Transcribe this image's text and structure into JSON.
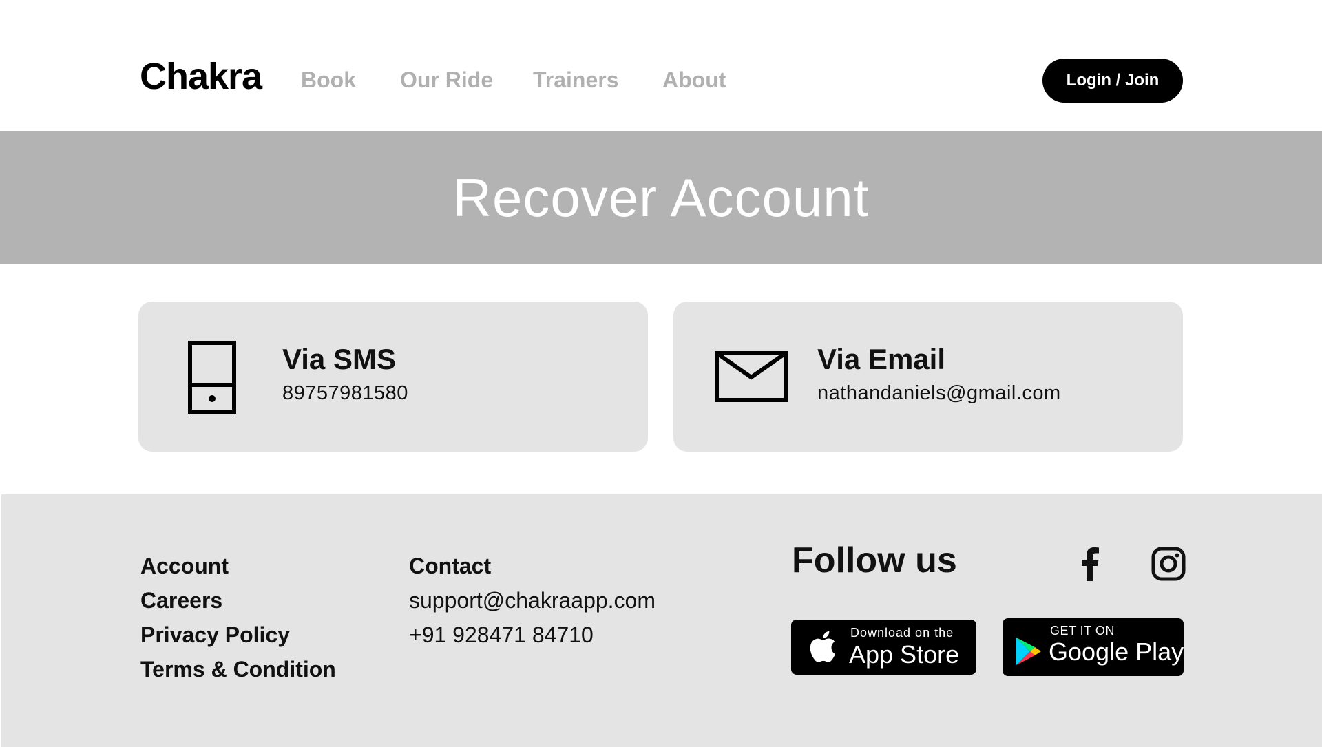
{
  "header": {
    "logo": "Chakra",
    "nav": [
      {
        "label": "Book"
      },
      {
        "label": "Our Ride"
      },
      {
        "label": "Trainers"
      },
      {
        "label": "About"
      }
    ],
    "login_label": "Login / Join"
  },
  "hero": {
    "title": "Recover Account"
  },
  "options": {
    "sms": {
      "title": "Via SMS",
      "value": "89757981580",
      "icon": "phone-icon"
    },
    "email": {
      "title": "Via Email",
      "value": "nathandaniels@gmail.com",
      "icon": "envelope-icon"
    }
  },
  "footer": {
    "links": [
      "Account",
      "Careers",
      "Privacy Policy",
      "Terms & Condition"
    ],
    "contact": {
      "heading": "Contact",
      "email": "support@chakraapp.com",
      "phone": "+91 928471 84710"
    },
    "follow_label": "Follow us",
    "social_icons": [
      "facebook-icon",
      "instagram-icon"
    ],
    "app_store": {
      "small": "Download on the",
      "big": "App Store"
    },
    "google_play": {
      "small": "GET IT ON",
      "big": "Google Play"
    }
  },
  "colors": {
    "hero_bg": "#b3b3b3",
    "card_bg": "#e4e4e4",
    "nav_text": "#b0b0b0",
    "primary": "#000000"
  }
}
